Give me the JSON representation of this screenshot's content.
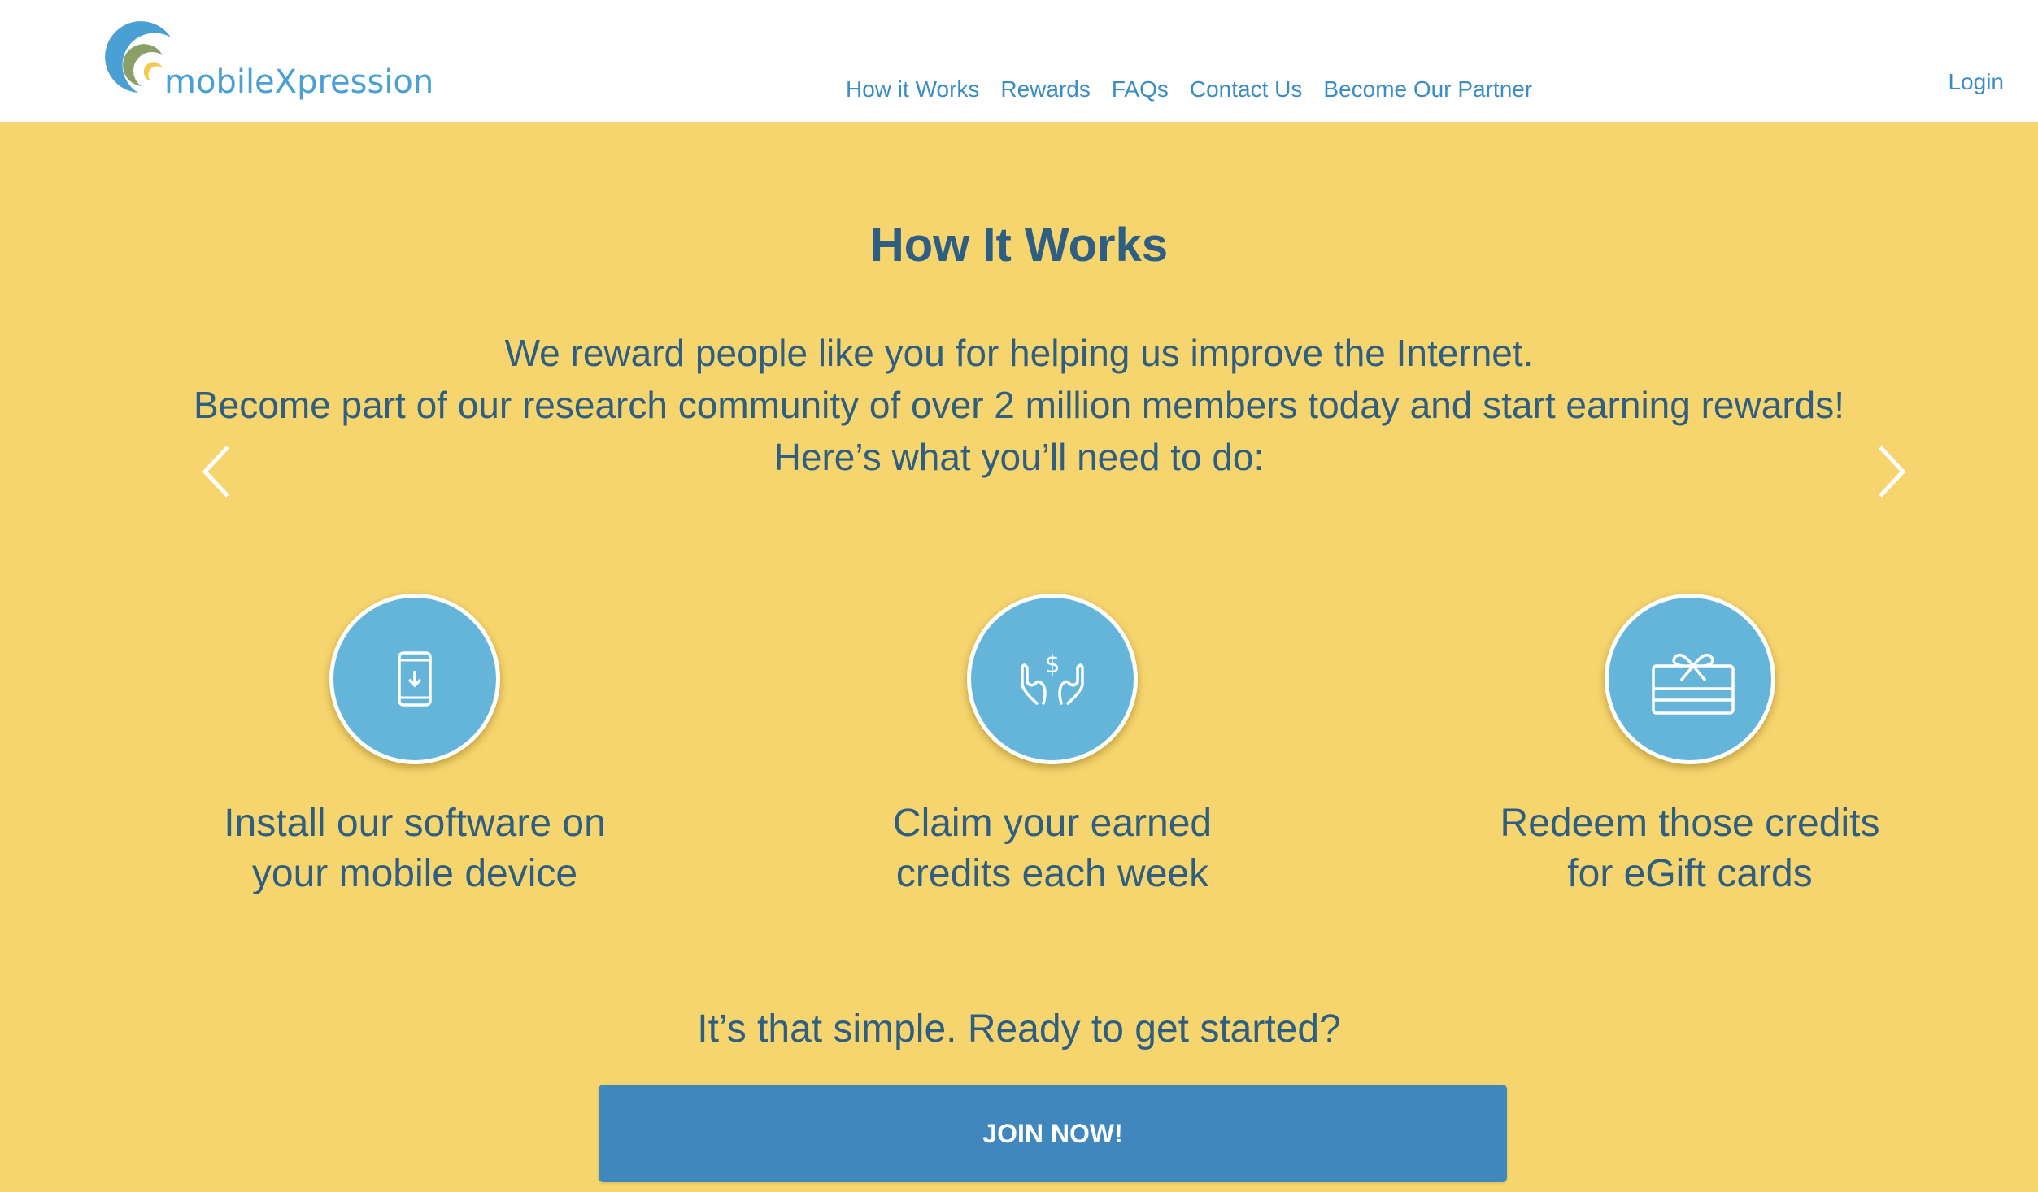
{
  "header": {
    "logo_text": "mobileXpression",
    "nav": [
      {
        "label": "How it Works"
      },
      {
        "label": "Rewards"
      },
      {
        "label": "FAQs"
      },
      {
        "label": "Contact Us"
      },
      {
        "label": "Become Our Partner"
      }
    ],
    "login_label": "Login"
  },
  "hero": {
    "title": "How It Works",
    "intro_lines": [
      "We reward people like you for helping us improve the Internet.",
      "Become part of our research community of over 2 million members today and start earning rewards!",
      "Here’s what you’ll need to do:"
    ],
    "prev_icon": "chevron-left-icon",
    "next_icon": "chevron-right-icon",
    "steps": [
      {
        "icon": "mobile-download-icon",
        "lines": [
          "Install our software on",
          "your mobile device"
        ]
      },
      {
        "icon": "hands-dollar-icon",
        "lines": [
          "Claim your earned",
          "credits each week"
        ]
      },
      {
        "icon": "gift-card-icon",
        "lines": [
          "Redeem those credits",
          "for eGift cards"
        ]
      }
    ],
    "cta_text": "It’s that simple. Ready to get started?",
    "join_label": "JOIN NOW!"
  },
  "colors": {
    "background": "#f6d56e",
    "header_bg": "#ffffff",
    "text_primary": "#2e5e82",
    "link": "#3a8cc4",
    "circle": "#64b5d9",
    "button": "#4087bd"
  }
}
